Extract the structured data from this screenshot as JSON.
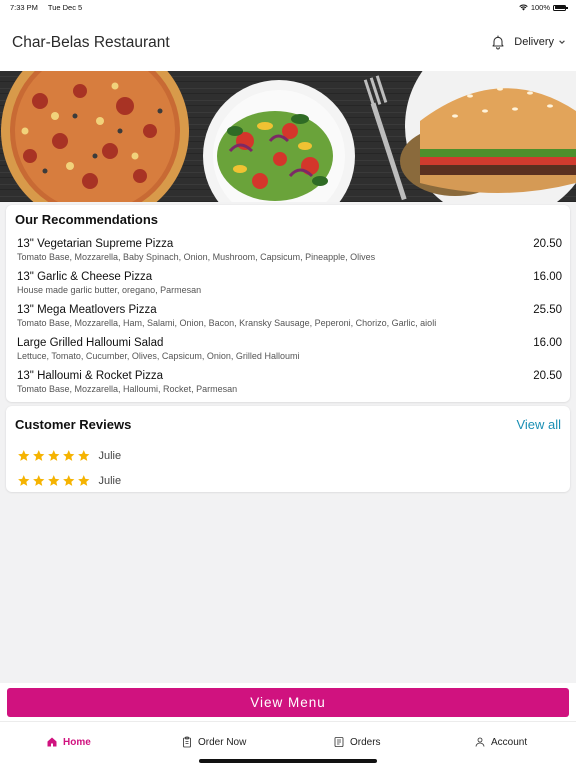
{
  "status_bar": {
    "time": "7:33 PM",
    "date": "Tue Dec 5",
    "battery": "100%",
    "battery_level": 1.0
  },
  "header": {
    "title": "Char-Belas Restaurant",
    "mode": "Delivery"
  },
  "recommendations": {
    "title": "Our Recommendations",
    "items": [
      {
        "name": "13\" Vegetarian Supreme Pizza",
        "desc": "Tomato Base, Mozzarella, Baby Spinach, Onion, Mushroom, Capsicum, Pineapple, Olives",
        "price": "20.50"
      },
      {
        "name": "13\" Garlic & Cheese Pizza",
        "desc": "House made garlic butter, oregano, Parmesan",
        "price": "16.00"
      },
      {
        "name": "13\" Mega Meatlovers Pizza",
        "desc": "Tomato Base, Mozzarella, Ham, Salami, Onion, Bacon, Kransky Sausage, Peperoni, Chorizo, Garlic, aioli",
        "price": "25.50"
      },
      {
        "name": "Large Grilled Halloumi Salad",
        "desc": "Lettuce, Tomato, Cucumber, Olives, Capsicum, Onion, Grilled Halloumi",
        "price": "16.00"
      },
      {
        "name": "13\" Halloumi & Rocket Pizza",
        "desc": "Tomato Base, Mozzarella, Halloumi, Rocket, Parmesan",
        "price": "20.50"
      }
    ]
  },
  "reviews": {
    "title": "Customer Reviews",
    "view_all": "View all",
    "items": [
      {
        "name": "Julie",
        "rating": 5
      },
      {
        "name": "Julie",
        "rating": 5
      }
    ]
  },
  "view_menu_label": "View Menu",
  "tabs": [
    {
      "label": "Home",
      "icon": "home-icon",
      "active": true
    },
    {
      "label": "Order Now",
      "icon": "clipboard-icon",
      "active": false
    },
    {
      "label": "Orders",
      "icon": "receipt-icon",
      "active": false
    },
    {
      "label": "Account",
      "icon": "user-icon",
      "active": false
    }
  ],
  "colors": {
    "accent": "#d0127f",
    "link": "#1a8fb4",
    "star": "#f5b301"
  }
}
